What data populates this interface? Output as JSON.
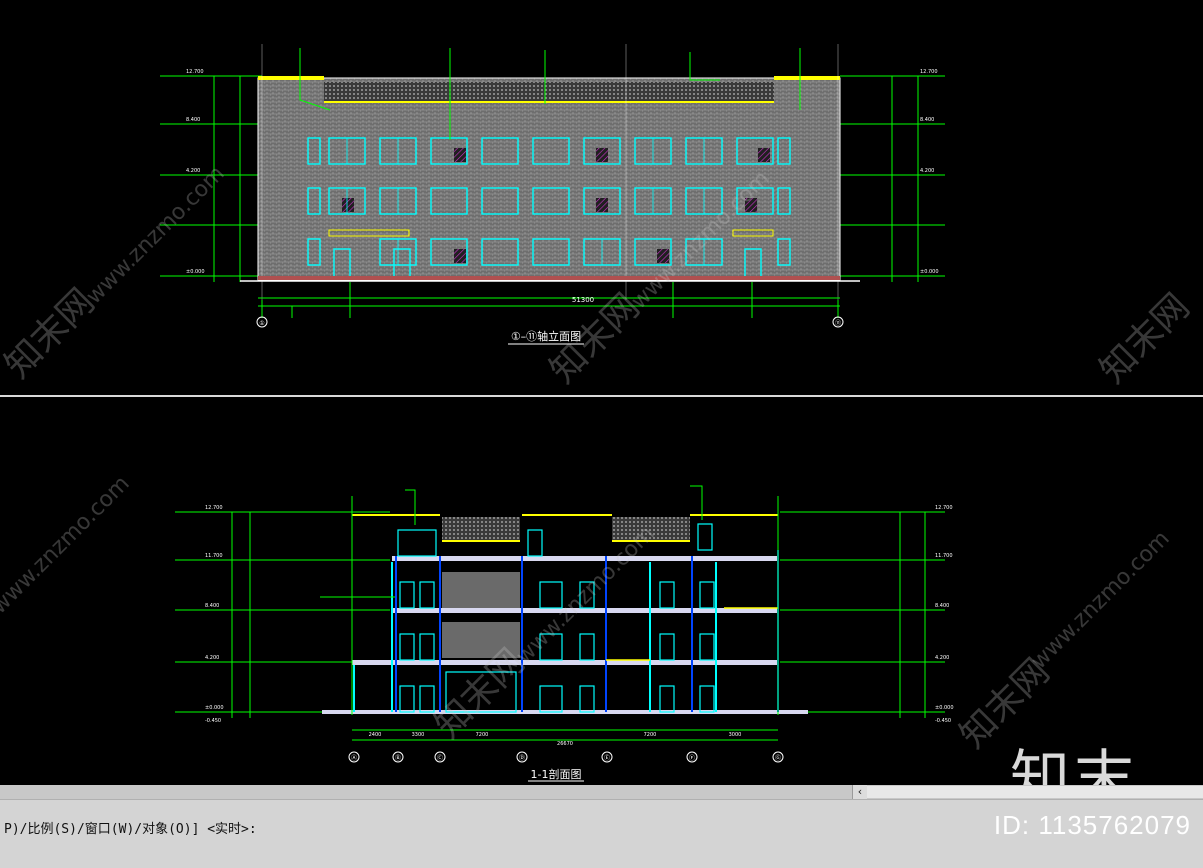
{
  "drawing": {
    "elevation_title": "①–⑪轴立面图",
    "section_title": "1-1剖面图",
    "elevation_total_dim": "51300",
    "section_total_dim": "26670",
    "elevation_axes": [
      "①",
      "⑪"
    ],
    "section_axes": [
      "Ⓐ",
      "Ⓑ",
      "Ⓒ",
      "Ⓓ",
      "Ⓔ",
      "Ⓕ",
      "Ⓖ"
    ],
    "level_labels": [
      "12.700",
      "11.700",
      "8.400",
      "4.200",
      "±0.000",
      "-0.450"
    ],
    "section_dims": [
      "2400",
      "3300",
      "7200",
      "7200",
      "3000"
    ]
  },
  "watermarks": {
    "site_cn": "知末网",
    "site_url": "www.znzmo.com",
    "brand_big": "知末"
  },
  "command_line": {
    "prompt": "P)/比例(S)/窗口(W)/对象(O)] <实时>:",
    "id_text": "ID: 1135762079"
  },
  "scrollbar": {
    "left_arrow": "‹"
  },
  "colors": {
    "background": "#000000",
    "dim_green": "#00ff00",
    "window_cyan": "#00ffff",
    "accent_yellow": "#ffff00",
    "facade_gray": "#8c8c8c",
    "hatch_magenta": "#cc33cc"
  }
}
